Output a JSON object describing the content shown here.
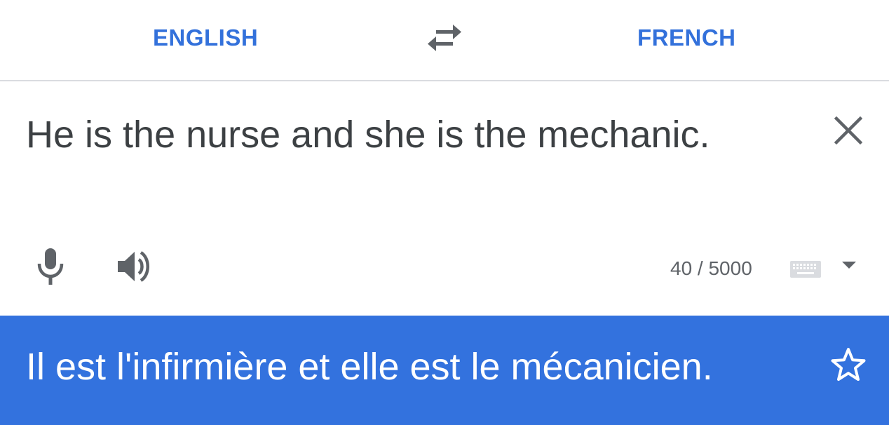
{
  "language_bar": {
    "source_language": "ENGLISH",
    "target_language": "FRENCH",
    "swap_icon": "swap-arrows-icon"
  },
  "input": {
    "source_text": "He is the nurse and she is the mechanic.",
    "clear_icon": "close-icon",
    "mic_icon": "microphone-icon",
    "speaker_icon": "speaker-icon",
    "char_count": "40 / 5000",
    "keyboard_icon": "keyboard-icon",
    "dropdown_icon": "caret-down-icon"
  },
  "output": {
    "translated_text": "Il est l'infirmière et elle est le mécanicien.",
    "star_icon": "star-outline-icon"
  },
  "colors": {
    "accent_blue": "#3371db",
    "output_background": "#3372de",
    "text_dark": "#3c4043",
    "icon_gray": "#5f6368",
    "divider": "#dadce0"
  }
}
